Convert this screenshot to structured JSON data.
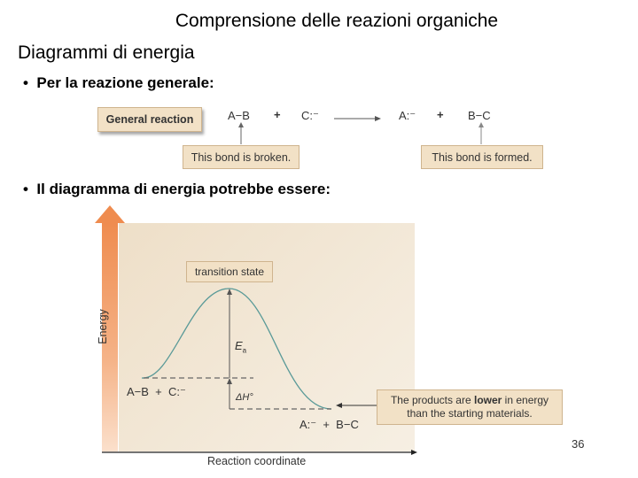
{
  "slide": {
    "title": "Comprensione delle reazioni organiche",
    "subtitle": "Diagrammi di energia",
    "bullets": [
      {
        "marker": "•",
        "text": "Per la reazione generale:"
      },
      {
        "marker": "•",
        "text": "Il diagramma di energia potrebbe essere:"
      }
    ],
    "page_number": "36"
  },
  "reaction": {
    "label": "General reaction",
    "reactant1": "A−B",
    "plus1": "+",
    "reactant2": "C:⁻",
    "product1": "A:⁻",
    "plus2": "+",
    "product2": "B−C",
    "broken_note": "This bond is broken.",
    "formed_note": "This bond is formed.",
    "arrow_icon": "right-arrow"
  },
  "energy_diagram": {
    "y_axis_label": "Energy",
    "x_axis_label": "Reaction coordinate",
    "transition_state_label": "transition state",
    "activation_energy_label": "E",
    "activation_energy_subscript": "a",
    "enthalpy_label": "ΔH°",
    "reactants_label": "A−B  +  C:⁻",
    "products_label": "A:⁻  +  B−C",
    "products_note_prefix": "The products are ",
    "products_note_bold": "lower",
    "products_note_suffix": " in energy",
    "products_note_line2": "than the starting materials.",
    "colors": {
      "curve": "#5a9a98",
      "axis_arrow": "#ef8c4f",
      "callout_bg": "#f2e1c6",
      "callout_border": "#cfb48e"
    },
    "relative_levels": {
      "reactants": 0.0,
      "transition_state": 1.0,
      "products": -0.37
    }
  }
}
